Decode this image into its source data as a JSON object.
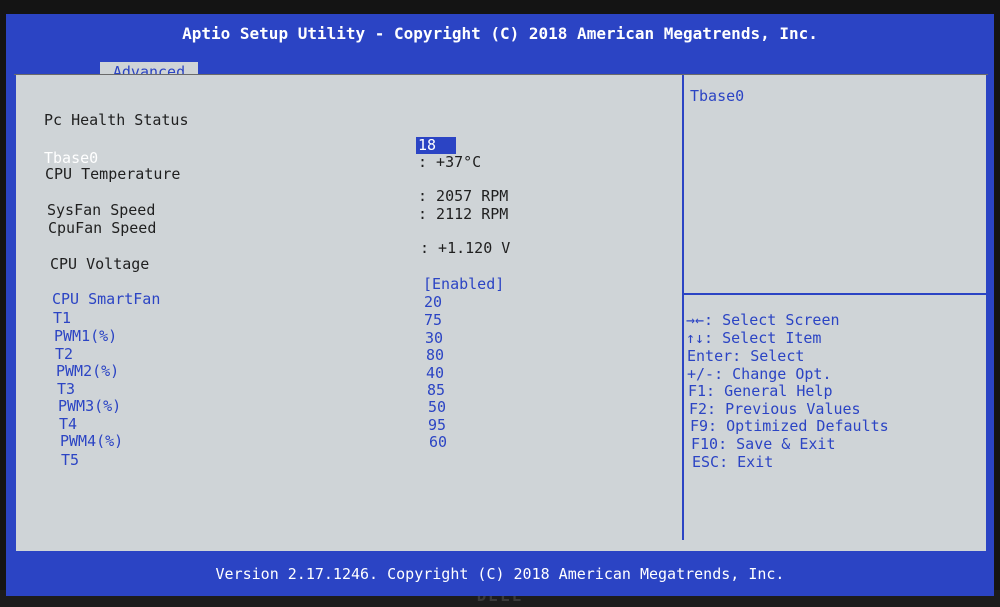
{
  "header": {
    "title": "Aptio Setup Utility - Copyright (C) 2018 American Megatrends, Inc."
  },
  "tabs": [
    {
      "label": "Advanced"
    }
  ],
  "section": {
    "title": "Pc Health Status"
  },
  "items": {
    "tbase0": {
      "label": "Tbase0",
      "value": "18"
    },
    "cpu_temp": {
      "label": "CPU Temperature",
      "value": ": +37°C"
    },
    "sysfan": {
      "label": "SysFan Speed",
      "value": ": 2057 RPM"
    },
    "cpufan": {
      "label": "CpuFan Speed",
      "value": ": 2112 RPM"
    },
    "cpu_voltage": {
      "label": "CPU Voltage",
      "value": ": +1.120 V"
    },
    "smartfan": {
      "label": "CPU SmartFan",
      "value": "[Enabled]"
    },
    "t1": {
      "label": "T1",
      "value": "20"
    },
    "pwm1": {
      "label": "PWM1(%)",
      "value": "75"
    },
    "t2": {
      "label": "T2",
      "value": "30"
    },
    "pwm2": {
      "label": "PWM2(%)",
      "value": "80"
    },
    "t3": {
      "label": "T3",
      "value": "40"
    },
    "pwm3": {
      "label": "PWM3(%)",
      "value": "85"
    },
    "t4": {
      "label": "T4",
      "value": "50"
    },
    "pwm4": {
      "label": "PWM4(%)",
      "value": "95"
    },
    "t5": {
      "label": "T5",
      "value": "60"
    }
  },
  "help": {
    "title": "Tbase0",
    "keys": [
      "→←: Select Screen",
      "↑↓: Select Item",
      "Enter: Select",
      "+/-: Change Opt.",
      "F1: General Help",
      "F2: Previous Values",
      "F9: Optimized Defaults",
      "F10: Save & Exit",
      "ESC: Exit"
    ]
  },
  "footer": {
    "text": "Version 2.17.1246. Copyright (C) 2018 American Megatrends, Inc."
  },
  "bezel": {
    "brand": "DELL"
  },
  "colors": {
    "bios_blue": "#2b44c4",
    "panel_gray": "#cfd4d7"
  }
}
